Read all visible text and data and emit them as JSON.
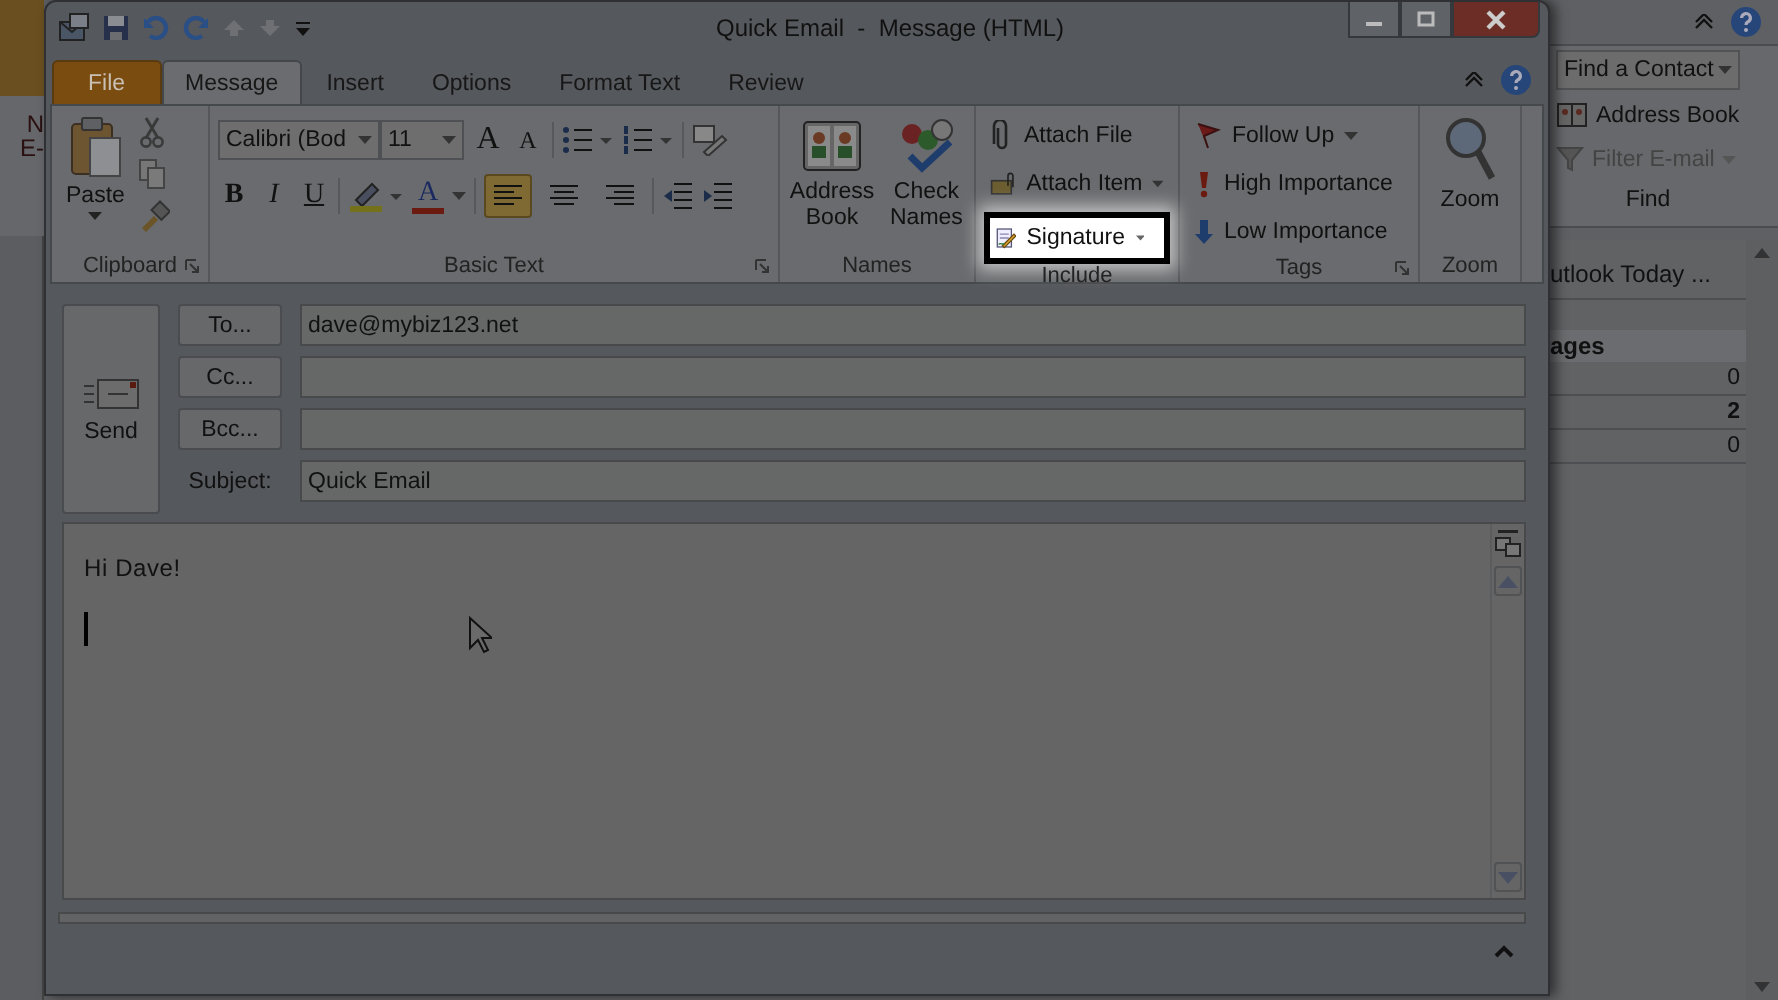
{
  "background_window": {
    "ribbon_labels": [
      "N",
      "E-"
    ],
    "find_group": {
      "items": [
        {
          "label": "Find a Contact",
          "kind": "search-box"
        },
        {
          "label": "Address Book",
          "kind": "book"
        },
        {
          "label": "Filter E-mail",
          "kind": "filter"
        }
      ],
      "label": "Find"
    },
    "pane": {
      "title": "utlook Today ...",
      "section": "ages",
      "counts": [
        {
          "value": "0",
          "unread": false
        },
        {
          "value": "2",
          "unread": true
        },
        {
          "value": "0",
          "unread": false
        }
      ]
    }
  },
  "window": {
    "title": "Quick Email  -  Message (HTML)"
  },
  "tabs": [
    {
      "label": "File",
      "kind": "file",
      "selected": false
    },
    {
      "label": "Message",
      "kind": "tab",
      "selected": true
    },
    {
      "label": "Insert",
      "kind": "tab",
      "selected": false
    },
    {
      "label": "Options",
      "kind": "tab",
      "selected": false
    },
    {
      "label": "Format Text",
      "kind": "tab",
      "selected": false
    },
    {
      "label": "Review",
      "kind": "tab",
      "selected": false
    }
  ],
  "ribbon": {
    "clipboard": {
      "paste": "Paste",
      "label": "Clipboard"
    },
    "basic_text": {
      "font": "Calibri (Bod",
      "size": "11",
      "grow": "A",
      "shrink": "A",
      "styles": [
        {
          "label": "B",
          "kind": "bold"
        },
        {
          "label": "I",
          "kind": "italic"
        },
        {
          "label": "U",
          "kind": "underline"
        }
      ],
      "font_color": "A",
      "alignment": [
        {
          "kind": "left",
          "selected": true
        },
        {
          "kind": "center",
          "selected": false
        },
        {
          "kind": "right",
          "selected": false
        }
      ],
      "label": "Basic Text"
    },
    "names": {
      "buttons": [
        {
          "label": "Address Book",
          "kind": "address-book"
        },
        {
          "label": "Check Names",
          "kind": "check-names"
        }
      ],
      "label": "Names"
    },
    "include": {
      "buttons": [
        {
          "label": "Attach File",
          "kind": "attach-file",
          "dropdown": false,
          "highlighted": false
        },
        {
          "label": "Attach Item",
          "kind": "attach-item",
          "dropdown": true,
          "highlighted": false
        },
        {
          "label": "Signature",
          "kind": "signature",
          "dropdown": true,
          "highlighted": true
        }
      ],
      "label": "Include"
    },
    "tags": {
      "buttons": [
        {
          "label": "Follow Up",
          "kind": "flag",
          "dropdown": true
        },
        {
          "label": "High Importance",
          "kind": "high",
          "dropdown": false
        },
        {
          "label": "Low Importance",
          "kind": "low",
          "dropdown": false
        }
      ],
      "label": "Tags"
    },
    "zoom": {
      "button": "Zoom",
      "label": "Zoom"
    }
  },
  "header": {
    "send": "Send",
    "recipients": [
      {
        "button": "To...",
        "value": "dave@mybiz123.net"
      },
      {
        "button": "Cc..."
      },
      {
        "button": "Bcc..."
      }
    ],
    "subject": {
      "label": "Subject:",
      "value": "Quick Email"
    }
  },
  "body": {
    "lines": [
      "Hi Dave!"
    ]
  }
}
